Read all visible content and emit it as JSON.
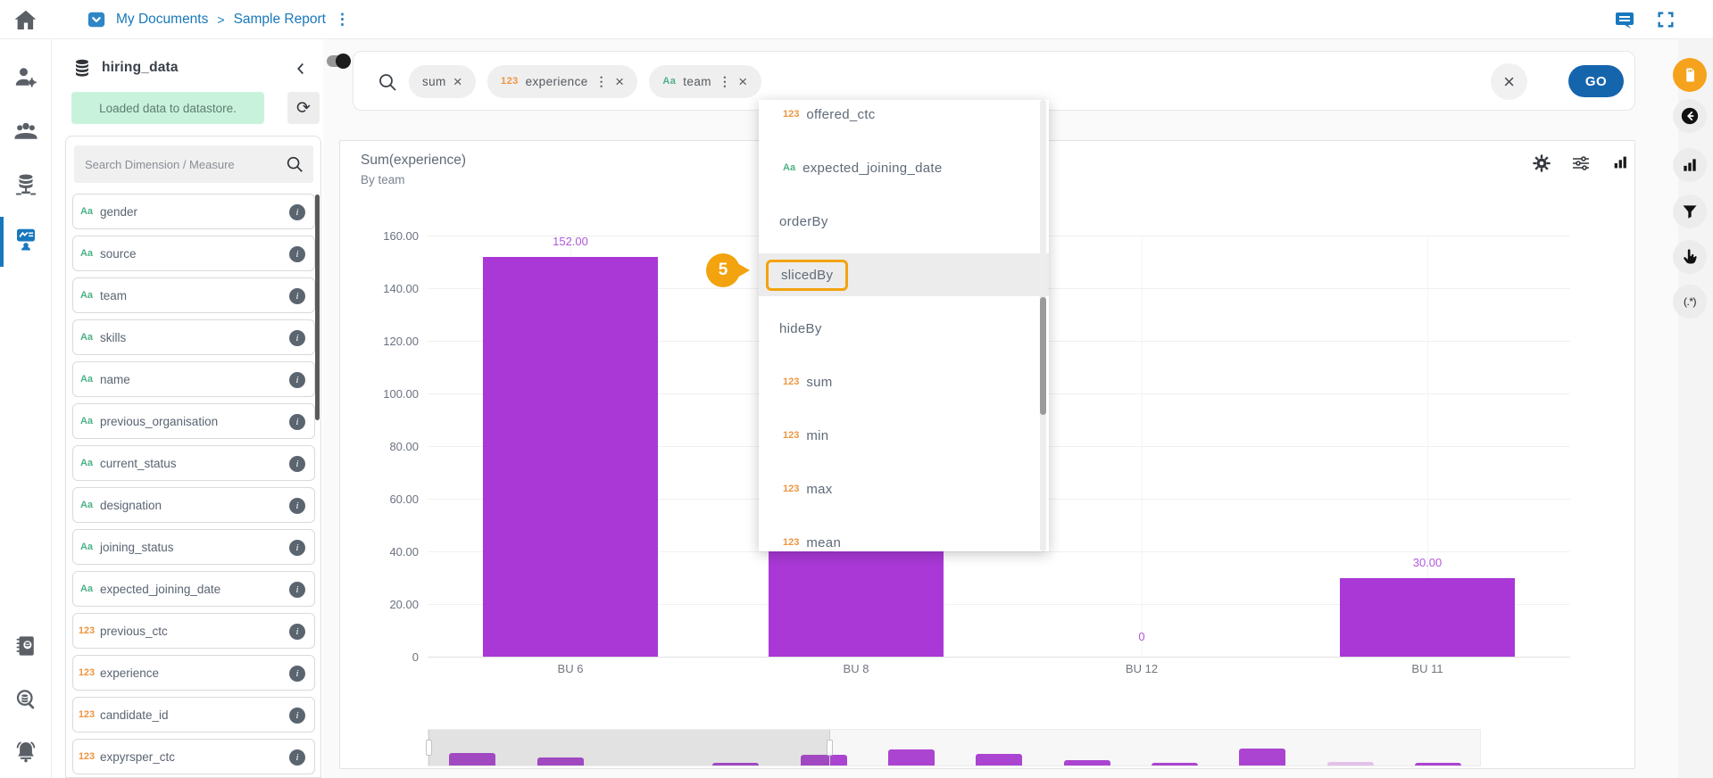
{
  "glyphs": {
    "info": "i",
    "kebab": "⋮",
    "remove": "×",
    "clear": "×",
    "refresh": "⟳",
    "caret": "▾"
  },
  "topbar": {
    "breadcrumb": {
      "root": "My Documents",
      "separator": ">",
      "current": "Sample Report"
    },
    "right_icons": [
      "comments",
      "fullscreen"
    ]
  },
  "left_rail": {
    "items": [
      "home",
      "user-settings",
      "teams",
      "datastore",
      "report-builder",
      "data-catalog",
      "data-search",
      "notifications"
    ],
    "active_item": "report-builder"
  },
  "sidebar": {
    "dataset_name": "hiring_data",
    "status_banner": "Loaded data to datastore.",
    "search_placeholder": "Search Dimension / Measure",
    "type_prefix": {
      "text": "Aa",
      "number": "123"
    },
    "fields": [
      {
        "type": "text",
        "label": "gender"
      },
      {
        "type": "text",
        "label": "source"
      },
      {
        "type": "text",
        "label": "team"
      },
      {
        "type": "text",
        "label": "skills"
      },
      {
        "type": "text",
        "label": "name"
      },
      {
        "type": "text",
        "label": "previous_organisation"
      },
      {
        "type": "text",
        "label": "current_status"
      },
      {
        "type": "text",
        "label": "designation"
      },
      {
        "type": "text",
        "label": "joining_status"
      },
      {
        "type": "text",
        "label": "expected_joining_date"
      },
      {
        "type": "number",
        "label": "previous_ctc"
      },
      {
        "type": "number",
        "label": "experience"
      },
      {
        "type": "number",
        "label": "candidate_id"
      },
      {
        "type": "number",
        "label": "expyrsper_ctc"
      }
    ]
  },
  "search_bar": {
    "chips": [
      {
        "label": "sum",
        "prefix": null,
        "menu": false
      },
      {
        "label": "experience",
        "prefix": "number",
        "menu": true
      },
      {
        "label": "team",
        "prefix": "text",
        "menu": true
      }
    ],
    "go_label": "GO"
  },
  "dropdown": {
    "step_badge": "5",
    "items": [
      {
        "label": "offered_ctc",
        "prefix": "number"
      },
      {
        "label": "expected_joining_date",
        "prefix": "text"
      },
      {
        "label": "orderBy",
        "prefix": null
      },
      {
        "label": "slicedBy",
        "prefix": null,
        "highlighted": true
      },
      {
        "label": "hideBy",
        "prefix": null
      },
      {
        "label": "sum",
        "prefix": "number"
      },
      {
        "label": "min",
        "prefix": "number"
      },
      {
        "label": "max",
        "prefix": "number"
      },
      {
        "label": "mean",
        "prefix": "number"
      }
    ]
  },
  "chart_toolbar": [
    "settings",
    "adjustments",
    "chart-type-picker"
  ],
  "right_rail": {
    "items": [
      "storage-card",
      "history-back",
      "chart-type",
      "filter",
      "pointer-tool",
      "regex-tool"
    ],
    "regex_label": "(.*)"
  },
  "chart_data": {
    "type": "bar",
    "title": "Sum(experience)",
    "subtitle": "By team",
    "categories": [
      "BU 6",
      "BU 8",
      "BU 12",
      "BU 11"
    ],
    "values": [
      152,
      90,
      0,
      30
    ],
    "value_labels": [
      "152.00",
      "",
      "0",
      "30.00"
    ],
    "ylim": [
      0,
      160
    ],
    "yticks": [
      "160.00",
      "140.00",
      "120.00",
      "100.00",
      "80.00",
      "60.00",
      "40.00",
      "20.00",
      "0"
    ],
    "grid": true,
    "legend": "none",
    "bar_color": "#a938d6",
    "label_color": "#b058d8",
    "navigator": {
      "minibar_heights": [
        14,
        9,
        0,
        3,
        12,
        18,
        13,
        6,
        3,
        19,
        4,
        3
      ],
      "light_bars": [
        10
      ],
      "selection_covers": "BU 6 – BU 11"
    }
  }
}
